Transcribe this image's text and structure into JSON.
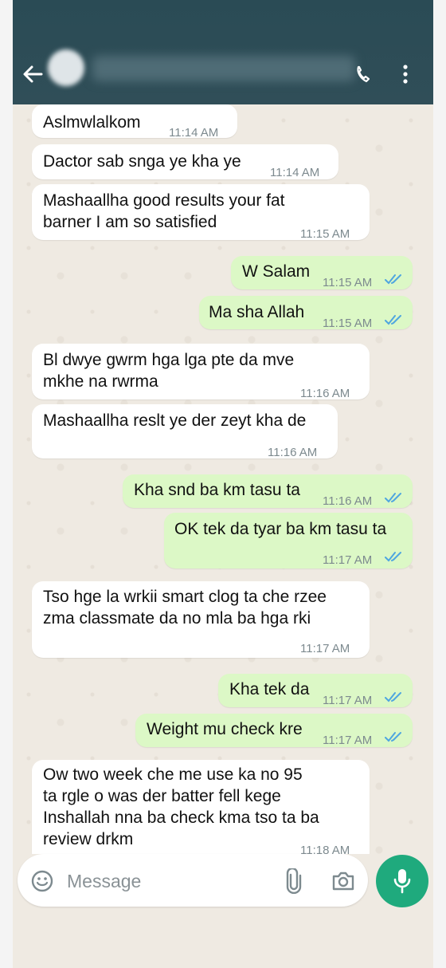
{
  "header": {
    "back_icon": "arrow-left-icon",
    "call_icon": "phone-icon",
    "menu_icon": "more-vertical-icon"
  },
  "messages": [
    {
      "dir": "in",
      "lines": [
        "Aslmwlalkom"
      ],
      "time": "11:14 AM"
    },
    {
      "dir": "in",
      "lines": [
        "Dactor sab snga ye kha ye"
      ],
      "time": "11:14 AM"
    },
    {
      "dir": "in",
      "lines": [
        "Mashaallha good results your fat",
        "barner I am so satisfied"
      ],
      "time": "11:15 AM"
    },
    {
      "dir": "out",
      "lines": [
        "W Salam"
      ],
      "time": "11:15 AM"
    },
    {
      "dir": "out",
      "lines": [
        "Ma sha Allah"
      ],
      "time": "11:15 AM"
    },
    {
      "dir": "in",
      "lines": [
        "Bl dwye gwrm hga lga pte da mve",
        "mkhe na rwrma"
      ],
      "time": "11:16 AM"
    },
    {
      "dir": "in",
      "lines": [
        "Mashaallha reslt ye der zeyt kha de"
      ],
      "time": "11:16 AM"
    },
    {
      "dir": "out",
      "lines": [
        "Kha snd ba km tasu ta"
      ],
      "time": "11:16 AM"
    },
    {
      "dir": "out",
      "lines": [
        "OK tek da tyar ba km tasu ta"
      ],
      "time": "11:17 AM"
    },
    {
      "dir": "in",
      "lines": [
        "Tso hge la wrkii smart clog ta che rzee",
        "zma classmate da no mla ba hga rki"
      ],
      "time": "11:17 AM"
    },
    {
      "dir": "out",
      "lines": [
        "Kha tek da"
      ],
      "time": "11:17 AM"
    },
    {
      "dir": "out",
      "lines": [
        "Weight mu check kre"
      ],
      "time": "11:17 AM"
    },
    {
      "dir": "in",
      "lines": [
        "Ow two week che me use ka no 95",
        "ta rgle o was der batter fell kege",
        "Inshallah nna ba check kma tso ta ba",
        "review drkm"
      ],
      "time": "11:18 AM"
    }
  ],
  "composer": {
    "placeholder": "Message",
    "emoji_icon": "emoji-icon",
    "attach_icon": "paperclip-icon",
    "camera_icon": "camera-icon",
    "mic_icon": "microphone-icon"
  },
  "colors": {
    "header": "#2d4c56",
    "incoming": "#ffffff",
    "outgoing": "#dcf8c6",
    "read_tick": "#4fa6e0",
    "mic_button": "#1faa7d"
  }
}
